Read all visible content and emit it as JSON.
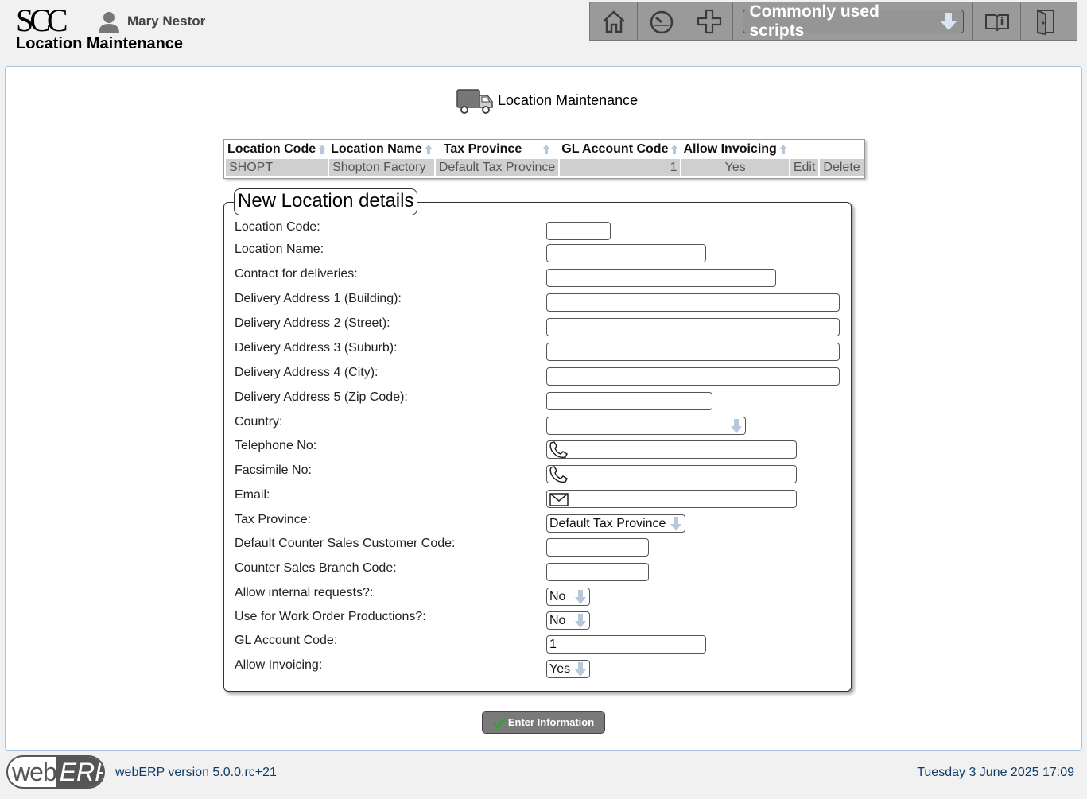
{
  "header": {
    "logo": "SCC",
    "user_name": "Mary Nestor",
    "page_heading": "Location Maintenance",
    "toolbar": {
      "home_icon": "home-icon",
      "dashboard_icon": "speedometer-icon",
      "add_icon": "plus-icon",
      "scripts_label": "Commonly used scripts",
      "manual_icon": "book-icon",
      "logout_icon": "exit-door-icon"
    }
  },
  "main": {
    "title": "Location Maintenance",
    "title_icon": "truck-icon",
    "table": {
      "headers": [
        "Location Code",
        "Location Name",
        "Tax Province",
        "GL Account Code",
        "Allow Invoicing"
      ],
      "rows": [
        {
          "code": "SHOPT",
          "name": "Shopton Factory",
          "tax_province": "Default Tax Province",
          "gl_account": "1",
          "allow_invoicing": "Yes",
          "edit": "Edit",
          "delete": "Delete"
        }
      ]
    },
    "form": {
      "legend": "New Location details",
      "fields": {
        "location_code": {
          "label": "Location Code:",
          "value": ""
        },
        "location_name": {
          "label": "Location Name:",
          "value": ""
        },
        "contact": {
          "label": "Contact for deliveries:",
          "value": ""
        },
        "addr1": {
          "label": "Delivery Address 1 (Building):",
          "value": ""
        },
        "addr2": {
          "label": "Delivery Address 2 (Street):",
          "value": ""
        },
        "addr3": {
          "label": "Delivery Address 3 (Suburb):",
          "value": ""
        },
        "addr4": {
          "label": "Delivery Address 4 (City):",
          "value": ""
        },
        "addr5": {
          "label": "Delivery Address 5 (Zip Code):",
          "value": ""
        },
        "country": {
          "label": "Country:",
          "value": ""
        },
        "telephone": {
          "label": "Telephone No:",
          "value": ""
        },
        "fax": {
          "label": "Facsimile No:",
          "value": ""
        },
        "email": {
          "label": "Email:",
          "value": ""
        },
        "tax_province": {
          "label": "Tax Province:",
          "value": "Default Tax Province"
        },
        "counter_customer": {
          "label": "Default Counter Sales Customer Code:",
          "value": ""
        },
        "counter_branch": {
          "label": "Counter Sales Branch Code:",
          "value": ""
        },
        "internal_requests": {
          "label": "Allow internal requests?:",
          "value": "No"
        },
        "work_orders": {
          "label": "Use for Work Order Productions?:",
          "value": "No"
        },
        "gl_account": {
          "label": "GL Account Code:",
          "value": "1"
        },
        "allow_invoicing": {
          "label": "Allow Invoicing:",
          "value": "Yes"
        }
      }
    },
    "submit_label": "Enter Information"
  },
  "footer": {
    "logo_web": "web",
    "logo_erp": "ERP",
    "version": "webERP version 5.0.0.rc+21",
    "datetime": "Tuesday 3 June 2025 17:09"
  }
}
